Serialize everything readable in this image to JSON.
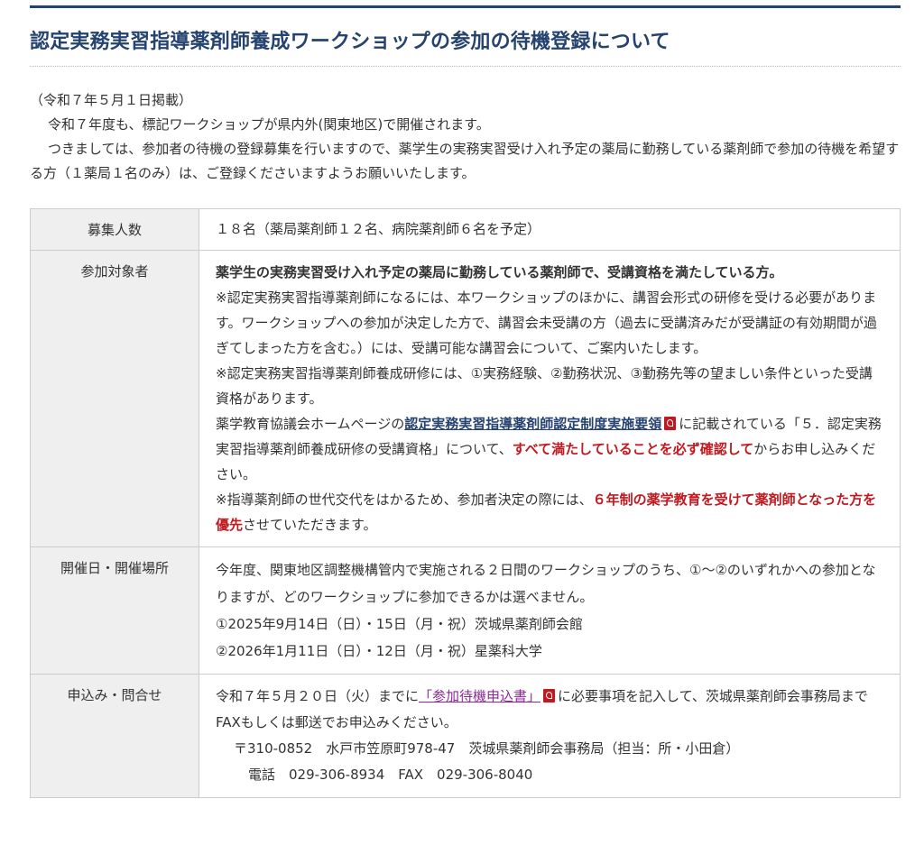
{
  "title": "認定実務実習指導薬剤師養成ワークショップの参加の待機登録について",
  "intro": {
    "date": "（令和７年５月１日掲載）",
    "line1": "令和７年度も、標記ワークショップが県内外(関東地区)で開催されます。",
    "line2": "つきましては、参加者の待機の登録募集を行いますので、薬学生の実務実習受け入れ予定の薬局に勤務している薬剤師で参加の待機を希望する方（１薬局１名のみ）は、ご登録くださいますようお願いいたします。"
  },
  "table": {
    "recruit": {
      "label": "募集人数",
      "value": "１８名（薬局薬剤師１２名、病院薬剤師６名を予定）"
    },
    "target": {
      "label": "参加対象者",
      "bold": "薬学生の実務実習受け入れ予定の薬局に勤務している薬剤師で、受講資格を満たしている方。",
      "note1": "※認定実務実習指導薬剤師になるには、本ワークショップのほかに、講習会形式の研修を受ける必要があります。ワークショップへの参加が決定した方で、講習会未受講の方（過去に受講済みだが受講証の有効期間が過ぎてしまった方を含む。）には、受講可能な講習会について、ご案内いたします。",
      "note2": "※認定実務実習指導薬剤師養成研修には、①実務経験、②勤務状況、③勤務先等の望ましい条件といった受講資格があります。",
      "p3_pre": "薬学教育協議会ホームページの",
      "p3_link": "認定実務実習指導薬剤師認定制度実施要領",
      "p3_mid": "に記載されている「５．認定実務実習指導薬剤師養成研修の受講資格」について、",
      "p3_red": "すべて満たしていることを必ず確認して",
      "p3_post": "からお申し込みください。",
      "p4_pre": "※指導薬剤師の世代交代をはかるため、参加者決定の際には、",
      "p4_red": "６年制の薬学教育を受けて薬剤師となった方を優先",
      "p4_post": "させていただきます。"
    },
    "dates": {
      "label": "開催日・開催場所",
      "desc": "今年度、関東地区調整機構管内で実施される２日間のワークショップのうち、①〜②のいずれかへの参加となりますが、どのワークショップに参加できるかは選べません。",
      "item1": "①2025年9月14日（日）・15日（月・祝）茨城県薬剤師会館",
      "item2": "②2026年1月11日（日）・12日（月・祝）星薬科大学"
    },
    "apply": {
      "label": "申込み・問合せ",
      "pre": "令和７年５月２０日（火）までに",
      "link": "「参加待機申込書」",
      "post": "に必要事項を記入して、茨城県薬剤師会事務局までFAXもしくは郵送でお申込みください。",
      "address": "〒310-0852　水戸市笠原町978-47　茨城県薬剤師会事務局（担当：所・小田倉）",
      "contact": "電話　029-306-8934　FAX　029-306-8040"
    }
  }
}
